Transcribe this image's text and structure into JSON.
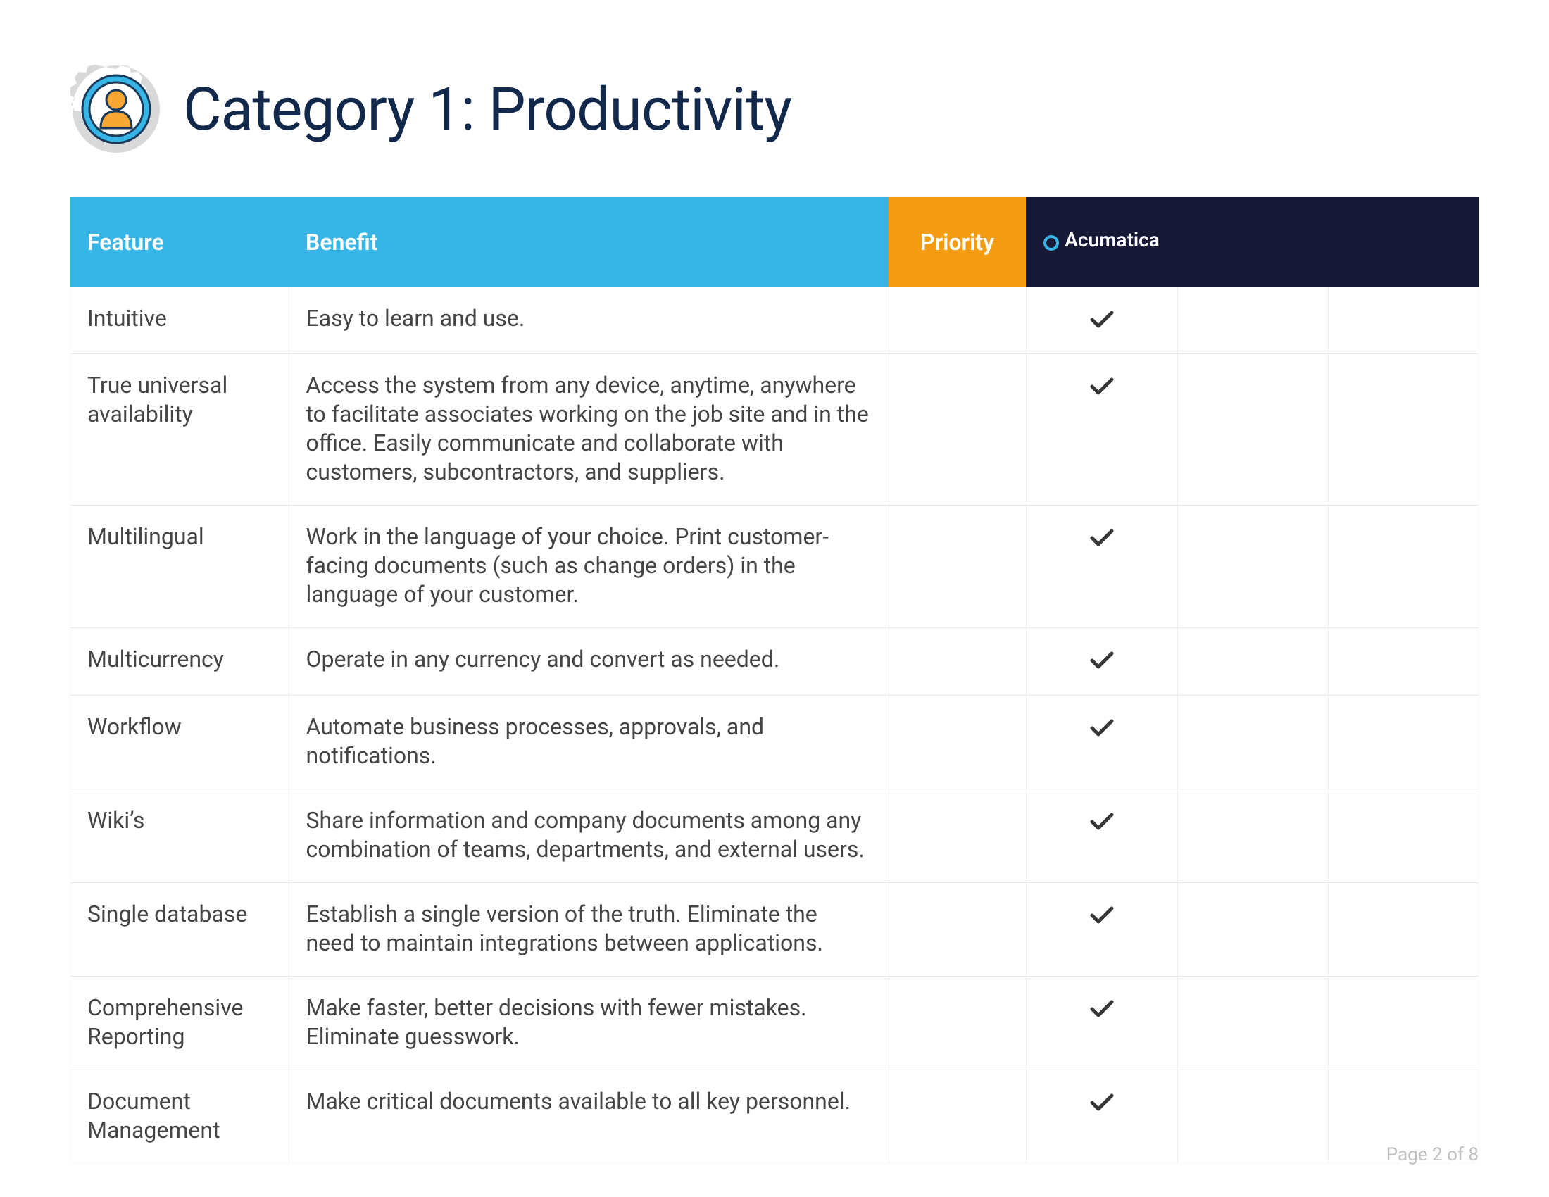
{
  "title": "Category 1: Productivity",
  "columns": {
    "feature": "Feature",
    "benefit": "Benefit",
    "priority": "Priority",
    "brand": "Acumatica"
  },
  "rows": [
    {
      "feature": "Intuitive",
      "benefit": "Easy to learn and use.",
      "brand_check": true
    },
    {
      "feature": "True universal availability",
      "benefit": "Access the system from any device, anytime, anywhere to facilitate associates working on the job site and in the office. Easily communicate and collaborate with customers, subcontractors, and suppliers.",
      "brand_check": true
    },
    {
      "feature": "Multilingual",
      "benefit": "Work in the language of your choice. Print customer-facing documents (such as change orders) in the language of your customer.",
      "brand_check": true
    },
    {
      "feature": "Multicurrency",
      "benefit": "Operate in any currency and convert as needed.",
      "brand_check": true
    },
    {
      "feature": "Workflow",
      "benefit": "Automate business processes, approvals, and notifications.",
      "brand_check": true
    },
    {
      "feature": "Wiki’s",
      "benefit": "Share information and company documents among any combination of teams, departments, and external users.",
      "brand_check": true
    },
    {
      "feature": "Single database",
      "benefit": "Establish a single version of the truth. Eliminate the need to maintain integrations between applications.",
      "brand_check": true
    },
    {
      "feature": "Comprehensive Reporting",
      "benefit": "Make faster, better decisions with fewer mistakes. Eliminate guesswork.",
      "brand_check": true
    },
    {
      "feature": "Document Management",
      "benefit": "Make critical documents available to all key personnel.",
      "brand_check": true
    }
  ],
  "footer": {
    "page_current": 2,
    "page_total": 8,
    "label": "Page 2 of 8"
  },
  "colors": {
    "header_blue": "#36b5e6",
    "header_orange": "#f39c12",
    "header_dark": "#151936",
    "title_navy": "#13294b",
    "icon_inner_blue": "#36b5e6",
    "icon_person_orange": "#f7a533"
  }
}
